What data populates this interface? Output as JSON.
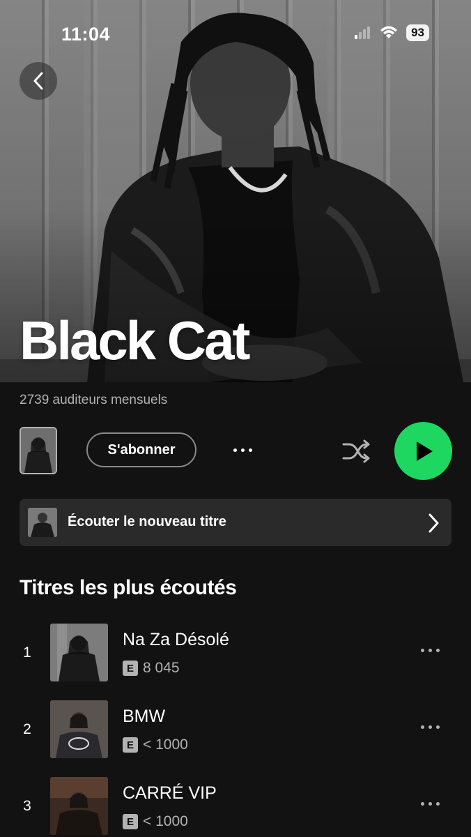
{
  "status_bar": {
    "time": "11:04",
    "battery": "93",
    "icons": [
      "signal-icon",
      "wifi-icon",
      "battery-icon"
    ]
  },
  "hero": {
    "artist_name": "Black Cat",
    "back_icon": "chevron-left-icon"
  },
  "artist": {
    "monthly_listeners": "2739 auditeurs mensuels"
  },
  "actions": {
    "follow_label": "S'abonner",
    "more_icon": "ellipsis-icon",
    "shuffle_icon": "shuffle-icon",
    "play_icon": "play-icon"
  },
  "new_release": {
    "label": "Écouter le nouveau titre",
    "chevron_icon": "chevron-right-icon"
  },
  "top_tracks": {
    "title": "Titres les plus écoutés",
    "items": [
      {
        "rank": "1",
        "title": "Na Za Désolé",
        "explicit": "E",
        "plays": "8 045"
      },
      {
        "rank": "2",
        "title": "BMW",
        "explicit": "E",
        "plays": "< 1000"
      },
      {
        "rank": "3",
        "title": "CARRÉ VIP",
        "explicit": "E",
        "plays": "< 1000"
      }
    ]
  },
  "colors": {
    "background": "#121212",
    "accent_green": "#1ed760",
    "secondary_text": "#b3b3b3",
    "card": "#2a2a2a"
  }
}
